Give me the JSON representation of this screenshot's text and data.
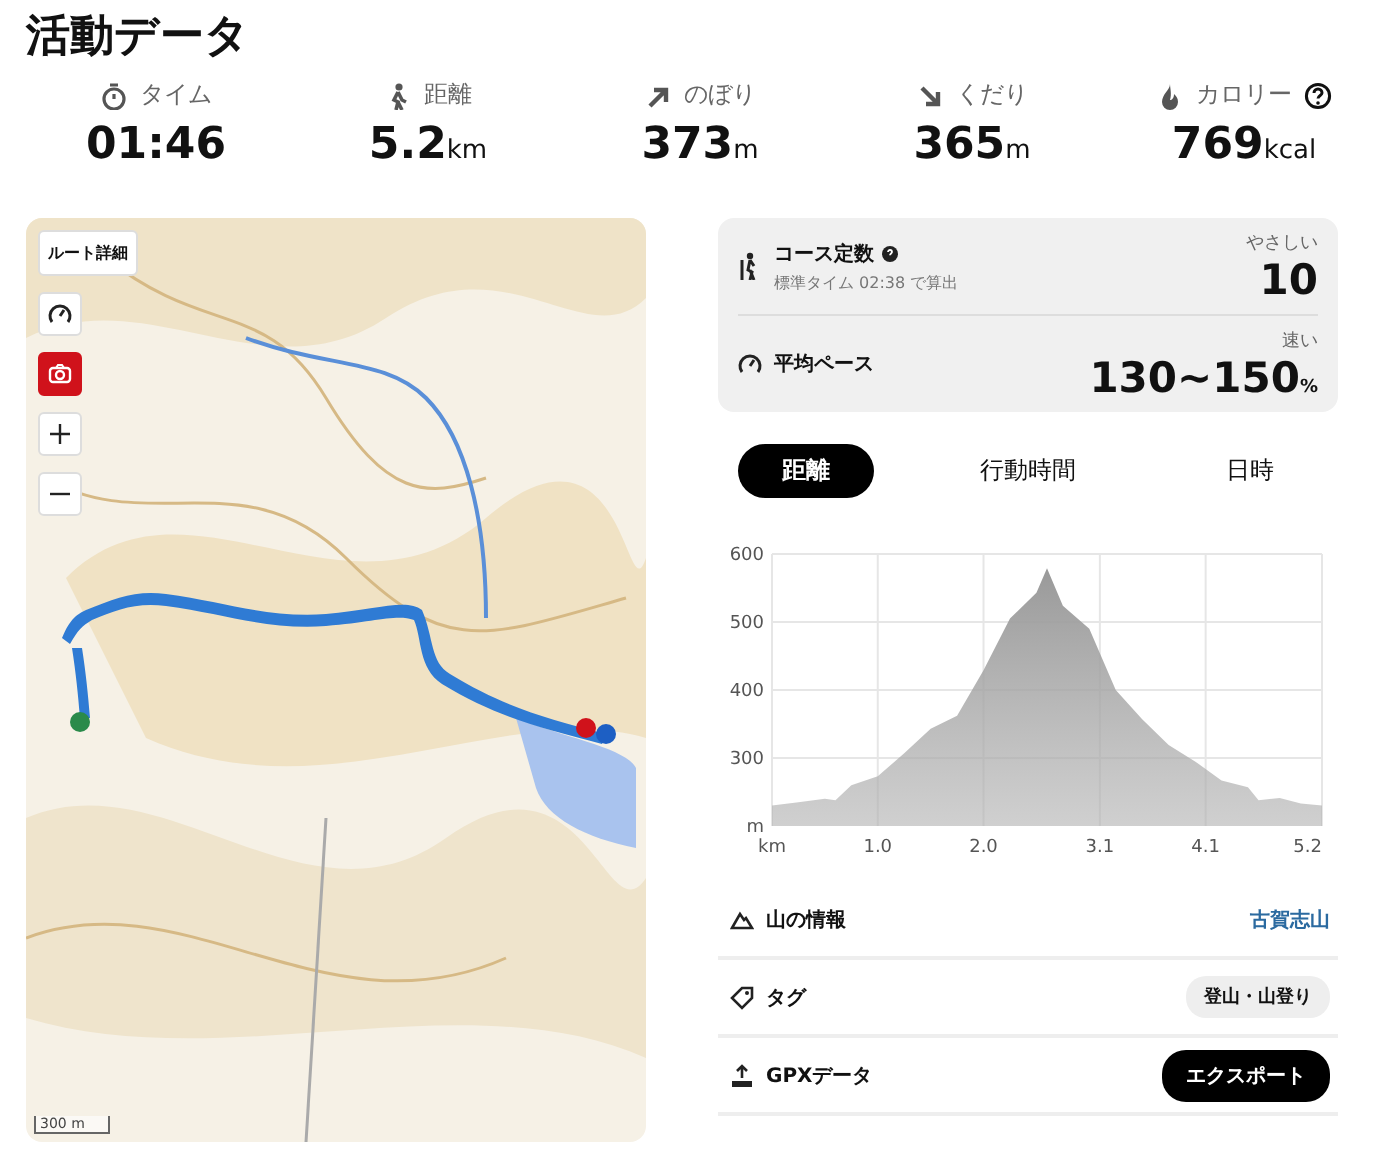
{
  "title": "活動データ",
  "stats": [
    {
      "kind": "time",
      "label": "タイム",
      "value": "01:46",
      "help": false
    },
    {
      "kind": "distance",
      "label": "距離",
      "value": "5.2",
      "unit": "km",
      "help": false
    },
    {
      "kind": "ascent",
      "label": "のぼり",
      "value": "373",
      "unit": "m",
      "help": false
    },
    {
      "kind": "descent",
      "label": "くだり",
      "value": "365",
      "unit": "m",
      "help": false
    },
    {
      "kind": "calories",
      "label": "カロリー",
      "value": "769",
      "unit": "kcal",
      "help": true
    }
  ],
  "map": {
    "kind": "picture",
    "route_button": "ルート詳細",
    "scale": "300 m"
  },
  "course_card": [
    {
      "kind": "course",
      "label": "コース定数",
      "note": "標準タイム 02:38 で算出",
      "rating": "やさしい",
      "value": "10"
    },
    {
      "kind": "pace",
      "label": "平均ペース",
      "rating": "速い",
      "value": "130~150",
      "unit": "%"
    }
  ],
  "tabs": [
    {
      "label": "距離",
      "selected": true
    },
    {
      "label": "行動時間",
      "selected": false
    },
    {
      "label": "日時",
      "selected": false
    }
  ],
  "chart_data": {
    "type": "area",
    "xlabel": "km",
    "ylabel": "m",
    "x": [
      0,
      0.25,
      0.5,
      0.6,
      0.75,
      1.0,
      1.25,
      1.5,
      1.75,
      2.0,
      2.25,
      2.5,
      2.6,
      2.75,
      3.0,
      3.25,
      3.5,
      3.75,
      4.0,
      4.25,
      4.5,
      4.6,
      4.8,
      5.0,
      5.2
    ],
    "series": [
      {
        "color": "#b0b0b0",
        "values": [
          230,
          235,
          240,
          238,
          260,
          273,
          307,
          343,
          362,
          429,
          505,
          543,
          579,
          524,
          490,
          400,
          357,
          319,
          295,
          267,
          257,
          238,
          241,
          233,
          230
        ]
      }
    ],
    "xlim": [
      0,
      5.2
    ],
    "ylim": [
      200,
      600
    ],
    "grid": true,
    "xticks": [
      {
        "value": 1.0,
        "label": "1.0"
      },
      {
        "value": 2.0,
        "label": "2.0"
      },
      {
        "value": 3.1,
        "label": "3.1"
      },
      {
        "value": 4.1,
        "label": "4.1"
      },
      {
        "value": 5.2,
        "label": "5.2"
      }
    ],
    "yticks": [
      300,
      400,
      500,
      600
    ]
  },
  "info_rows": [
    {
      "kind": "mountain",
      "label": "山の情報",
      "value": "古賀志山"
    },
    {
      "kind": "tag",
      "label": "タグ",
      "value": "登山・山登り"
    },
    {
      "kind": "gpx",
      "label": "GPXデータ",
      "value": "エクスポート"
    }
  ]
}
